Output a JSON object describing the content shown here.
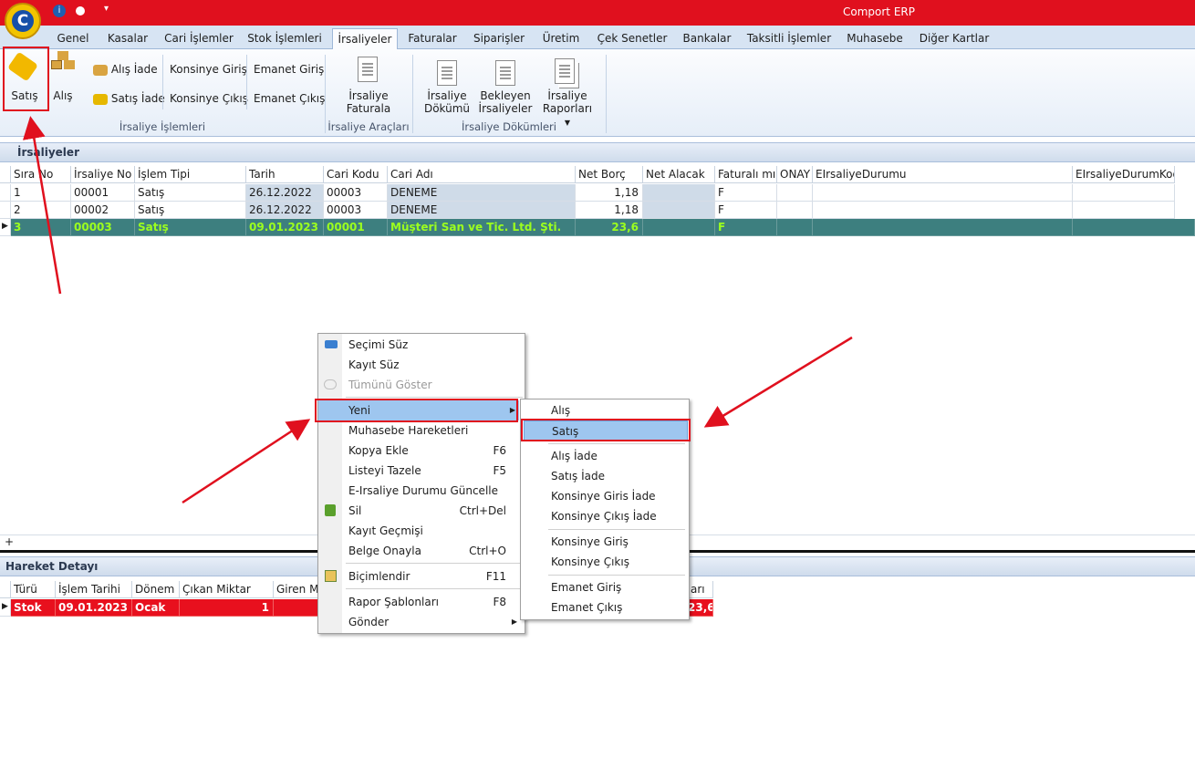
{
  "app": {
    "title": "Comport ERP"
  },
  "tabs": [
    "Genel",
    "Kasalar",
    "Cari İşlemler",
    "Stok İşlemleri",
    "İrsaliyeler",
    "Faturalar",
    "Siparişler",
    "Üretim",
    "Çek Senetler",
    "Bankalar",
    "Taksitli İşlemler",
    "Muhasebe",
    "Diğer Kartlar"
  ],
  "ribbon": {
    "satis": "Satış",
    "alis": "Alış",
    "alis_iade": "Alış İade",
    "satis_iade": "Satış İade",
    "konsinye_giris": "Konsinye Giriş",
    "konsinye_cikis": "Konsinye Çıkış",
    "emanet_giris": "Emanet Giriş",
    "emanet_cikis": "Emanet Çıkış",
    "group1": "İrsaliye İşlemleri",
    "irsaliye_faturala_1": "İrsaliye",
    "irsaliye_faturala_2": "Faturala",
    "group2": "İrsaliye Araçları",
    "irsaliye_dokumu_1": "İrsaliye",
    "irsaliye_dokumu_2": "Dökümü",
    "bekleyen_1": "Bekleyen",
    "bekleyen_2": "İrsaliyeler",
    "raporlari_1": "İrsaliye",
    "raporlari_2": "Raporları",
    "group3": "İrsaliye Dökümleri"
  },
  "irsaliyeler": {
    "title": "İrsaliyeler",
    "columns": [
      "Sıra No",
      "İrsaliye No",
      "İşlem Tipi",
      "Tarih",
      "Cari Kodu",
      "Cari Adı",
      "Net Borç",
      "Net Alacak",
      "Faturalı mı?",
      "ONAY",
      "EIrsaliyeDurumu",
      "EIrsaliyeDurumKodu"
    ],
    "rows": [
      [
        "1",
        "00001",
        "Satış",
        "26.12.2022",
        "00003",
        "DENEME",
        "1,18",
        "",
        "F",
        "",
        "",
        ""
      ],
      [
        "2",
        "00002",
        "Satış",
        "26.12.2022",
        "00003",
        "DENEME",
        "1,18",
        "",
        "F",
        "",
        "",
        ""
      ],
      [
        "3",
        "00003",
        "Satış",
        "09.01.2023",
        "00001",
        "Müşteri San ve Tic. Ltd. Şti.",
        "23,6",
        "",
        "F",
        "",
        "",
        ""
      ]
    ],
    "add_row": "+"
  },
  "hareket": {
    "title": "Hareket Detayı",
    "columns": [
      "Türü",
      "İşlem Tarihi",
      "Dönem",
      "Çıkan Miktar",
      "Giren Mi"
    ],
    "row": [
      "Stok",
      "09.01.2023",
      "Ocak",
      "1",
      ""
    ],
    "right_header": "arı",
    "right_value": "23,6"
  },
  "context_menu": {
    "items": [
      {
        "label": "Seçimi Süz",
        "shortcut": ""
      },
      {
        "label": "Kayıt Süz",
        "shortcut": ""
      },
      {
        "label": "Tümünü Göster",
        "shortcut": ""
      },
      {
        "label": "Yeni",
        "shortcut": ""
      },
      {
        "label": "Muhasebe Hareketleri",
        "shortcut": ""
      },
      {
        "label": "Kopya Ekle",
        "shortcut": "F6"
      },
      {
        "label": "Listeyi Tazele",
        "shortcut": "F5"
      },
      {
        "label": "E-Irsaliye Durumu Güncelle",
        "shortcut": ""
      },
      {
        "label": "Sil",
        "shortcut": "Ctrl+Del"
      },
      {
        "label": "Kayıt Geçmişi",
        "shortcut": ""
      },
      {
        "label": "Belge Onayla",
        "shortcut": "Ctrl+O"
      },
      {
        "label": "Biçimlendir",
        "shortcut": "F11"
      },
      {
        "label": "Rapor Şablonları",
        "shortcut": "F8"
      },
      {
        "label": "Gönder",
        "shortcut": ""
      }
    ]
  },
  "submenu": {
    "items": [
      "Alış",
      "Satış",
      "Alış İade",
      "Satış İade",
      "Konsinye Giris İade",
      "Konsinye Çıkış İade",
      "Konsinye Giriş",
      "Konsinye Çıkış",
      "Emanet Giriş",
      "Emanet Çıkış"
    ]
  },
  "colors": {
    "titlebar": "#e0101e",
    "selected_row": "#3d7f7f",
    "selected_text": "#9cff1e",
    "highlight": "#9ec6ef",
    "annotation": "#e0101e"
  }
}
